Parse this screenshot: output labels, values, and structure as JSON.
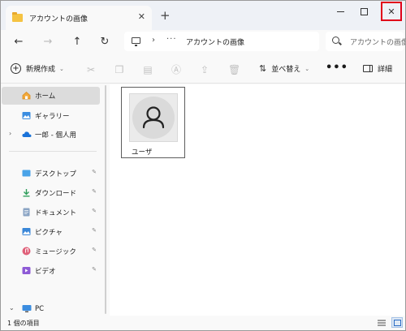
{
  "window": {
    "tab_title": "アカウントの画像",
    "tab_close": "✕",
    "new_tab": "+",
    "minimize_label": "",
    "close_glyph": "✕"
  },
  "address": {
    "back": "←",
    "forward": "→",
    "up": "↑",
    "refresh": "↻",
    "chevron": "›",
    "overflow": "···",
    "crumb": "アカウントの画像",
    "search_placeholder": "アカウントの画像"
  },
  "toolbar": {
    "new_label": "新規作成",
    "new_caret": "⌄",
    "sort_label": "並べ替え",
    "sort_caret": "⌄",
    "more": "•••",
    "details_label": "詳細",
    "disabled_icons": [
      "cut-icon",
      "copy-icon",
      "paste-icon",
      "rename-icon",
      "share-icon",
      "delete-icon"
    ]
  },
  "sidebar": {
    "home": "ホーム",
    "gallery": "ギャラリー",
    "onedrive": "一郎 - 個人用",
    "desktop": "デスクトップ",
    "downloads": "ダウンロード",
    "documents": "ドキュメント",
    "pictures": "ピクチャ",
    "music": "ミュージック",
    "videos": "ビデオ",
    "pc": "PC",
    "expand": "›",
    "expand_open": "⌄",
    "pin": "📌"
  },
  "content": {
    "file_name": "ユーザ"
  },
  "status": {
    "item_count": "1 個の項目"
  },
  "colors": {
    "accent_close_border": "#e0001a",
    "folder_yellow": "#f5c342",
    "selected_bg": "#dcdcdc"
  }
}
